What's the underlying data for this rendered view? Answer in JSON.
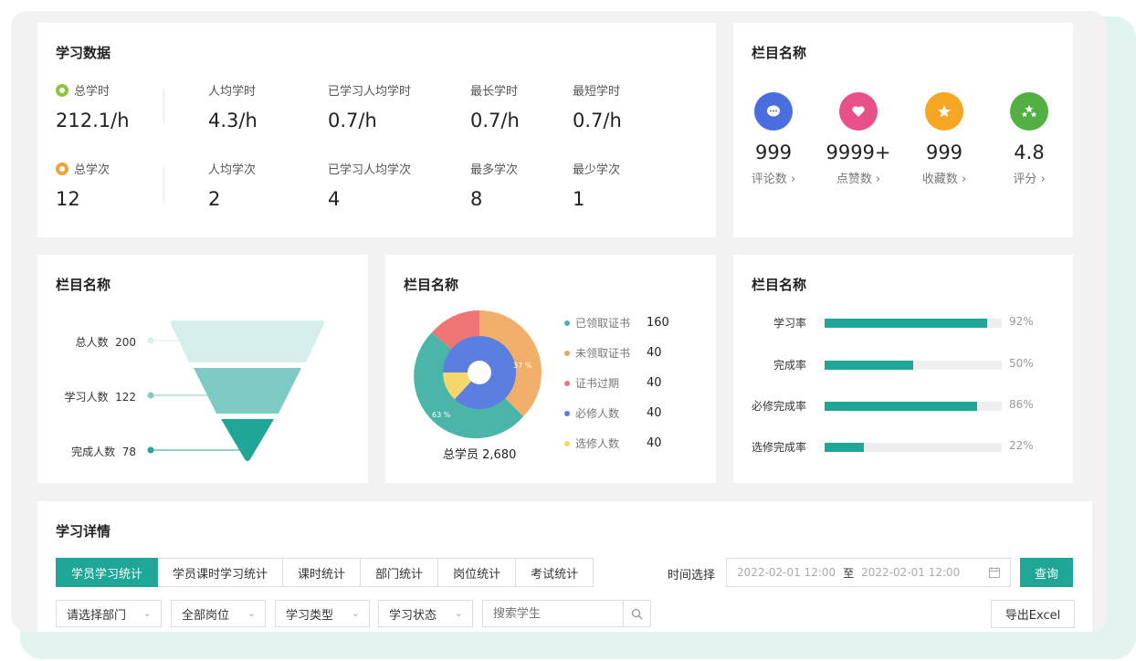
{
  "study_data": {
    "title": "学习数据",
    "rows": [
      {
        "icon": "clock-icon",
        "items": [
          {
            "label": "总学时",
            "value": "212.1/h"
          },
          {
            "label": "人均学时",
            "value": "4.3/h"
          },
          {
            "label": "已学习人均学时",
            "value": "0.7/h"
          },
          {
            "label": "最长学时",
            "value": "0.7/h"
          },
          {
            "label": "最短学时",
            "value": "0.7/h"
          }
        ]
      },
      {
        "icon": "count-icon",
        "items": [
          {
            "label": "总学次",
            "value": "12"
          },
          {
            "label": "人均学次",
            "value": "2"
          },
          {
            "label": "已学习人均学次",
            "value": "4"
          },
          {
            "label": "最多学次",
            "value": "8"
          },
          {
            "label": "最少学次",
            "value": "1"
          }
        ]
      }
    ],
    "colors": {
      "clock": "#8cc63f",
      "count": "#f5a03a"
    }
  },
  "engagement": {
    "title": "栏目名称",
    "items": [
      {
        "icon": "comment-icon",
        "value": "999",
        "label": "评论数 ›",
        "color": "#4a6ee0"
      },
      {
        "icon": "heart-icon",
        "value": "9999+",
        "label": "点赞数 ›",
        "color": "#e8508a"
      },
      {
        "icon": "star-icon",
        "value": "999",
        "label": "收藏数 ›",
        "color": "#f5a623"
      },
      {
        "icon": "stars-icon",
        "value": "4.8",
        "label": "评分 ›",
        "color": "#52b043"
      }
    ]
  },
  "funnel": {
    "title": "栏目名称",
    "stages": [
      {
        "label": "总人数",
        "value": "200",
        "color": "#d6efec"
      },
      {
        "label": "学习人数",
        "value": "122",
        "color": "#7fcbc3"
      },
      {
        "label": "完成人数",
        "value": "78",
        "color": "#1fa696"
      }
    ]
  },
  "donut": {
    "title": "栏目名称",
    "total_label": "总学员",
    "total_value": "2,680",
    "outer_labels": [
      "37 %",
      "63 %"
    ],
    "legend": [
      {
        "label": "已领取证书",
        "value": "160",
        "color": "#4ab5a8"
      },
      {
        "label": "未领取证书",
        "value": "40",
        "color": "#f0a35e"
      },
      {
        "label": "证书过期",
        "value": "40",
        "color": "#f07676"
      },
      {
        "label": "必修人数",
        "value": "40",
        "color": "#5b7ee0"
      },
      {
        "label": "选修人数",
        "value": "40",
        "color": "#f5d76e"
      }
    ]
  },
  "rates": {
    "title": "栏目名称",
    "items": [
      {
        "label": "学习率",
        "pct": "92%",
        "value": 92
      },
      {
        "label": "完成率",
        "pct": "50%",
        "value": 50
      },
      {
        "label": "必修完成率",
        "pct": "86%",
        "value": 86
      },
      {
        "label": "选修完成率",
        "pct": "22%",
        "value": 22
      }
    ]
  },
  "details": {
    "title": "学习详情",
    "tabs": [
      "学员学习统计",
      "学员课时学习统计",
      "课时统计",
      "部门统计",
      "岗位统计",
      "考试统计"
    ],
    "time_label": "时间选择",
    "date_start": "2022-02-01 12:00",
    "date_sep": "至",
    "date_end": "2022-02-01 12:00",
    "query_label": "查询",
    "filters": [
      "请选择部门",
      "全部岗位",
      "学习类型",
      "学习状态"
    ],
    "search_placeholder": "搜索学生",
    "export_label": "导出Excel"
  },
  "colors": {
    "accent": "#1fa696"
  }
}
